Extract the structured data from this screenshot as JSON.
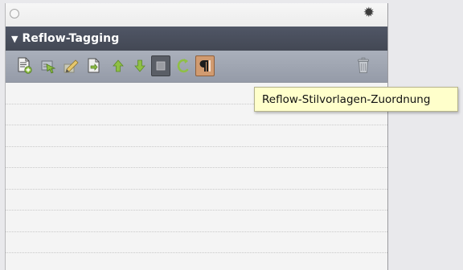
{
  "panel": {
    "header_title": "Reflow-Tagging",
    "expand_glyph": "▼",
    "gear_glyph": "✹"
  },
  "toolbar": {
    "buttons": [
      {
        "icon": "new-page-icon"
      },
      {
        "icon": "tag-arrow-icon"
      },
      {
        "icon": "edit-tag-icon"
      },
      {
        "icon": "page-export-icon"
      },
      {
        "icon": "arrow-up-icon"
      },
      {
        "icon": "arrow-down-icon"
      },
      {
        "icon": "stop-square-icon",
        "state": "selected"
      },
      {
        "icon": "refresh-icon"
      },
      {
        "icon": "style-mapping-icon",
        "state": "active"
      },
      {
        "icon": "trash-icon"
      }
    ]
  },
  "tooltip": {
    "text": "Reflow-Stilvorlagen-Zuordnung"
  },
  "colors": {
    "header_bg": "#4a4f5c",
    "toolbar_bg": "#a0a6b2",
    "active_button": "#d19b70",
    "tooltip_bg": "#ffffcb",
    "icon_green": "#8fbf45"
  }
}
